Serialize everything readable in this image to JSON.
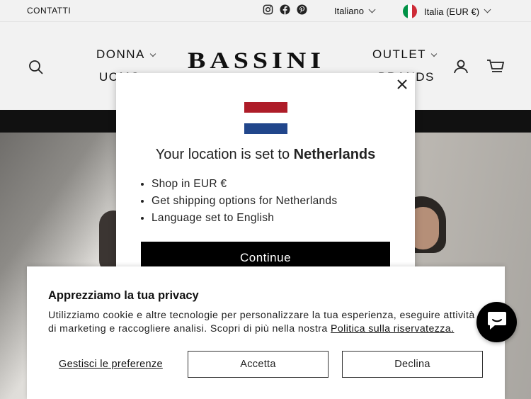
{
  "topbar": {
    "contact_label": "CONTATTI",
    "language": "Italiano",
    "country": "Italia (EUR €)",
    "social_icons": [
      "instagram-icon",
      "facebook-icon",
      "pinterest-icon"
    ]
  },
  "header": {
    "logo": "BASSINI",
    "nav_left": [
      "DONNA",
      "UOMO"
    ],
    "nav_right": [
      "OUTLET",
      "BRANDS"
    ]
  },
  "location_modal": {
    "title_prefix": "Your location is set to",
    "title_country": "Netherlands",
    "items": [
      "Shop in EUR €",
      "Get shipping options for Netherlands",
      "Language set to English"
    ],
    "continue_label": "Continue",
    "flag_colors": [
      "#ae1c28",
      "#ffffff",
      "#21468b"
    ]
  },
  "privacy": {
    "title": "Apprezziamo la tua privacy",
    "text_line1": "Utilizziamo cookie e altre tecnologie per personalizzare la tua esperienza, eseguire attività",
    "text_line2": "di marketing e raccogliere analisi. Scopri di più nella nostra",
    "policy_link": "Politica sulla riservatezza.",
    "preferences_label": "Gestisci le preferenze",
    "accept_label": "Accetta",
    "decline_label": "Declina"
  },
  "chat": {
    "icon": "chat-icon"
  }
}
